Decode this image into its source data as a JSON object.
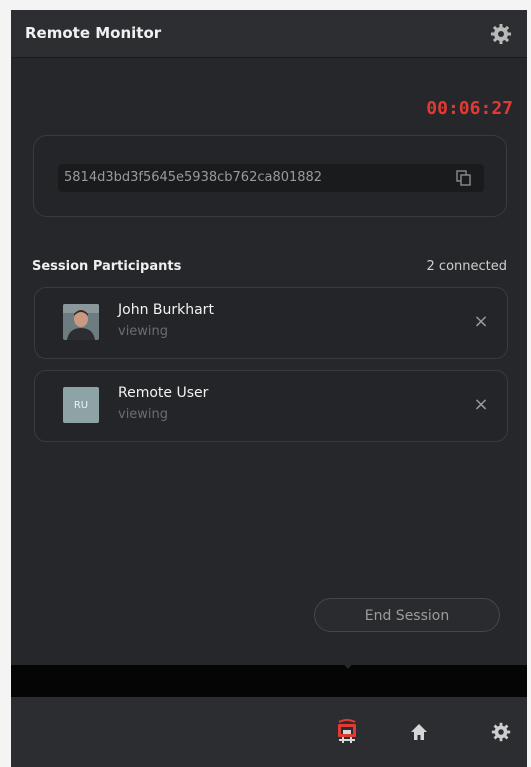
{
  "header": {
    "title": "Remote Monitor",
    "settings_icon": "gear-icon"
  },
  "session": {
    "timer": "00:06:27",
    "session_id": "5814d3bd3f5645e5938cb762ca801882",
    "copy_icon": "copy-icon"
  },
  "participants_section": {
    "title": "Session Participants",
    "count": "2 connected",
    "participants": [
      {
        "name": "John Burkhart",
        "status": "viewing",
        "avatar": "photo",
        "remove_icon": "×"
      },
      {
        "name": "Remote User",
        "status": "viewing",
        "avatar_initials": "RU",
        "remove_icon": "×"
      }
    ]
  },
  "actions": {
    "end_session": "End Session"
  },
  "bottom_nav": {
    "items": [
      {
        "icon": "monitor-icon",
        "active": true
      },
      {
        "icon": "home-icon",
        "active": false
      },
      {
        "icon": "gear-icon",
        "active": false
      }
    ]
  },
  "colors": {
    "accent_red": "#e23a33",
    "panel_bg": "#26272a"
  }
}
